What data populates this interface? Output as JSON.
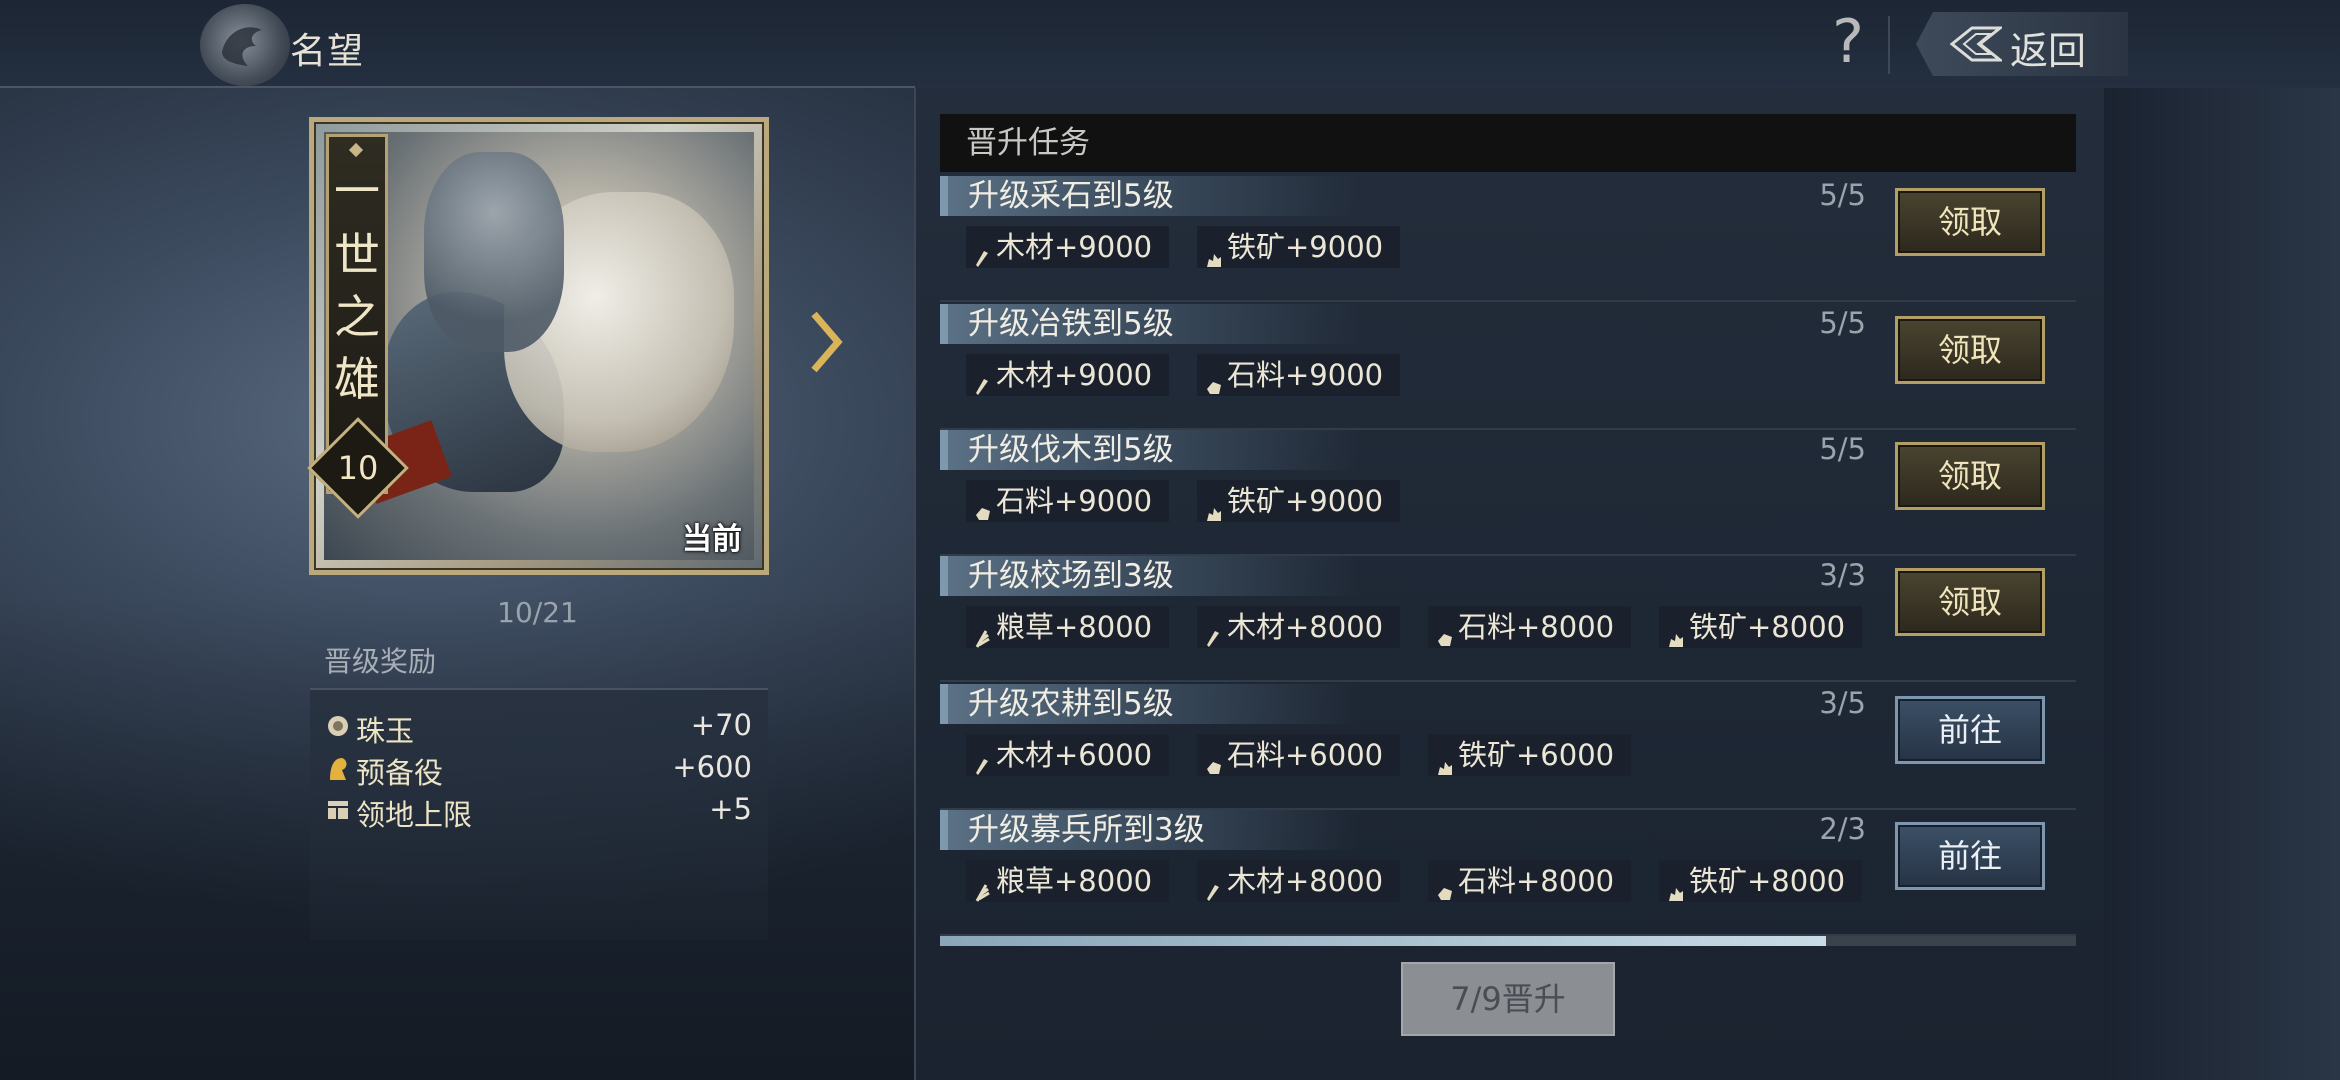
{
  "header": {
    "title": "名望",
    "help_glyph": "?",
    "back_label": "返回"
  },
  "card": {
    "title_chars": [
      "一",
      "世",
      "之",
      "雄"
    ],
    "level": "10",
    "current_label": "当前"
  },
  "progress_text": "10/21",
  "rewards": {
    "title": "晋级奖励",
    "items": [
      {
        "icon": "pearl-icon",
        "name": "珠玉",
        "value": "+70"
      },
      {
        "icon": "reserve-troops-icon",
        "name": "预备役",
        "value": "+600"
      },
      {
        "icon": "territory-icon",
        "name": "领地上限",
        "value": "+5"
      }
    ]
  },
  "tasks": {
    "header": "晋升任务",
    "items": [
      {
        "name": "升级采石到5级",
        "count": "5/5",
        "rewards": [
          {
            "icon": "wood-icon",
            "text": "木材+9000"
          },
          {
            "icon": "iron-icon",
            "text": "铁矿+9000"
          }
        ],
        "button": "领取",
        "button_style": "gold"
      },
      {
        "name": "升级冶铁到5级",
        "count": "5/5",
        "rewards": [
          {
            "icon": "wood-icon",
            "text": "木材+9000"
          },
          {
            "icon": "stone-icon",
            "text": "石料+9000"
          }
        ],
        "button": "领取",
        "button_style": "gold"
      },
      {
        "name": "升级伐木到5级",
        "count": "5/5",
        "rewards": [
          {
            "icon": "stone-icon",
            "text": "石料+9000"
          },
          {
            "icon": "iron-icon",
            "text": "铁矿+9000"
          }
        ],
        "button": "领取",
        "button_style": "gold"
      },
      {
        "name": "升级校场到3级",
        "count": "3/3",
        "rewards": [
          {
            "icon": "grain-icon",
            "text": "粮草+8000"
          },
          {
            "icon": "wood-icon",
            "text": "木材+8000"
          },
          {
            "icon": "stone-icon",
            "text": "石料+8000"
          },
          {
            "icon": "iron-icon",
            "text": "铁矿+8000"
          }
        ],
        "button": "领取",
        "button_style": "gold"
      },
      {
        "name": "升级农耕到5级",
        "count": "3/5",
        "rewards": [
          {
            "icon": "wood-icon",
            "text": "木材+6000"
          },
          {
            "icon": "stone-icon",
            "text": "石料+6000"
          },
          {
            "icon": "iron-icon",
            "text": "铁矿+6000"
          }
        ],
        "button": "前往",
        "button_style": "blue"
      },
      {
        "name": "升级募兵所到3级",
        "count": "2/3",
        "rewards": [
          {
            "icon": "grain-icon",
            "text": "粮草+8000"
          },
          {
            "icon": "wood-icon",
            "text": "木材+8000"
          },
          {
            "icon": "stone-icon",
            "text": "石料+8000"
          },
          {
            "icon": "iron-icon",
            "text": "铁矿+8000"
          }
        ],
        "button": "前往",
        "button_style": "blue"
      }
    ]
  },
  "promotion": {
    "progress_fraction": 0.78,
    "button": "7/9晋升"
  },
  "colors": {
    "gold": "#b39e64",
    "blue_button": "#7e97ae",
    "resource_text": "#ebe6d6"
  }
}
